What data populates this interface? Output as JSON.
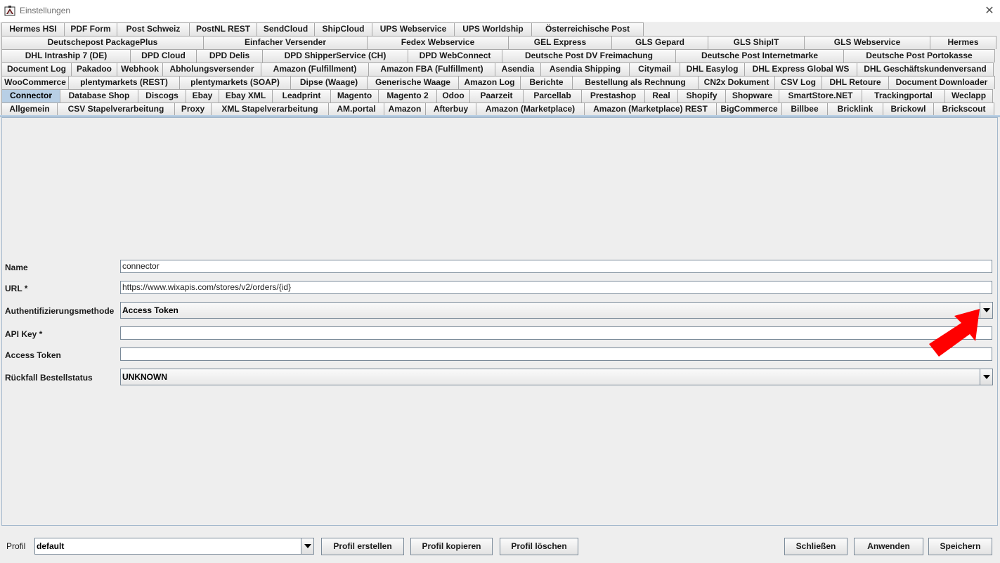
{
  "window": {
    "title": "Einstellungen",
    "close_glyph": "✕",
    "app_icon": "app-icon"
  },
  "tab_rows": [
    [
      "Hermes HSI",
      "PDF Form",
      "Post Schweiz",
      "PostNL REST",
      "SendCloud",
      "ShipCloud",
      "UPS Webservice",
      "UPS Worldship",
      "Österreichische Post"
    ],
    [
      "Deutschepost PackagePlus",
      "Einfacher Versender",
      "Fedex Webservice",
      "GEL Express",
      "GLS Gepard",
      "GLS ShipIT",
      "GLS Webservice",
      "Hermes"
    ],
    [
      "DHL Intraship 7 (DE)",
      "DPD Cloud",
      "DPD Delis",
      "DPD ShipperService (CH)",
      "DPD WebConnect",
      "Deutsche Post DV Freimachung",
      "Deutsche Post Internetmarke",
      "Deutsche Post Portokasse"
    ],
    [
      "Document Log",
      "Pakadoo",
      "Webhook",
      "Abholungsversender",
      "Amazon (Fulfillment)",
      "Amazon FBA (Fulfillment)",
      "Asendia",
      "Asendia Shipping",
      "Citymail",
      "DHL Easylog",
      "DHL Express Global WS",
      "DHL Geschäftskundenversand"
    ],
    [
      "WooCommerce",
      "plentymarkets (REST)",
      "plentymarkets (SOAP)",
      "Dipse (Waage)",
      "Generische Waage",
      "Amazon Log",
      "Berichte",
      "Bestellung als Rechnung",
      "CN2x Dokument",
      "CSV Log",
      "DHL Retoure",
      "Document Downloader"
    ],
    [
      "Connector",
      "Database Shop",
      "Discogs",
      "Ebay",
      "Ebay XML",
      "Leadprint",
      "Magento",
      "Magento 2",
      "Odoo",
      "Paarzeit",
      "Parcellab",
      "Prestashop",
      "Real",
      "Shopify",
      "Shopware",
      "SmartStore.NET",
      "Trackingportal",
      "Weclapp"
    ],
    [
      "Allgemein",
      "CSV Stapelverarbeitung",
      "Proxy",
      "XML Stapelverarbeitung",
      "AM.portal",
      "Amazon",
      "Afterbuy",
      "Amazon (Marketplace)",
      "Amazon (Marketplace) REST",
      "BigCommerce",
      "Billbee",
      "Bricklink",
      "Brickowl",
      "Brickscout"
    ]
  ],
  "selected_tab": "Connector",
  "form": {
    "name_label": "Name",
    "name_value": "connector",
    "url_label": "URL *",
    "url_value": "https://www.wixapis.com/stores/v2/orders/{id}",
    "auth_label": "Authentifizierungsmethode",
    "auth_value": "Access Token",
    "apikey_label": "API Key *",
    "apikey_value": "",
    "token_label": "Access Token",
    "token_value": "",
    "fallback_label": "Rückfall Bestellstatus",
    "fallback_value": "UNKNOWN"
  },
  "footer": {
    "profile_label": "Profil",
    "profile_value": "default",
    "create_label": "Profil erstellen",
    "copy_label": "Profil kopieren",
    "delete_label": "Profil löschen",
    "close_label": "Schließen",
    "apply_label": "Anwenden",
    "save_label": "Speichern"
  },
  "colors": {
    "selected_tab": "#b8cfe5",
    "annotation_arrow": "#ff0000"
  }
}
